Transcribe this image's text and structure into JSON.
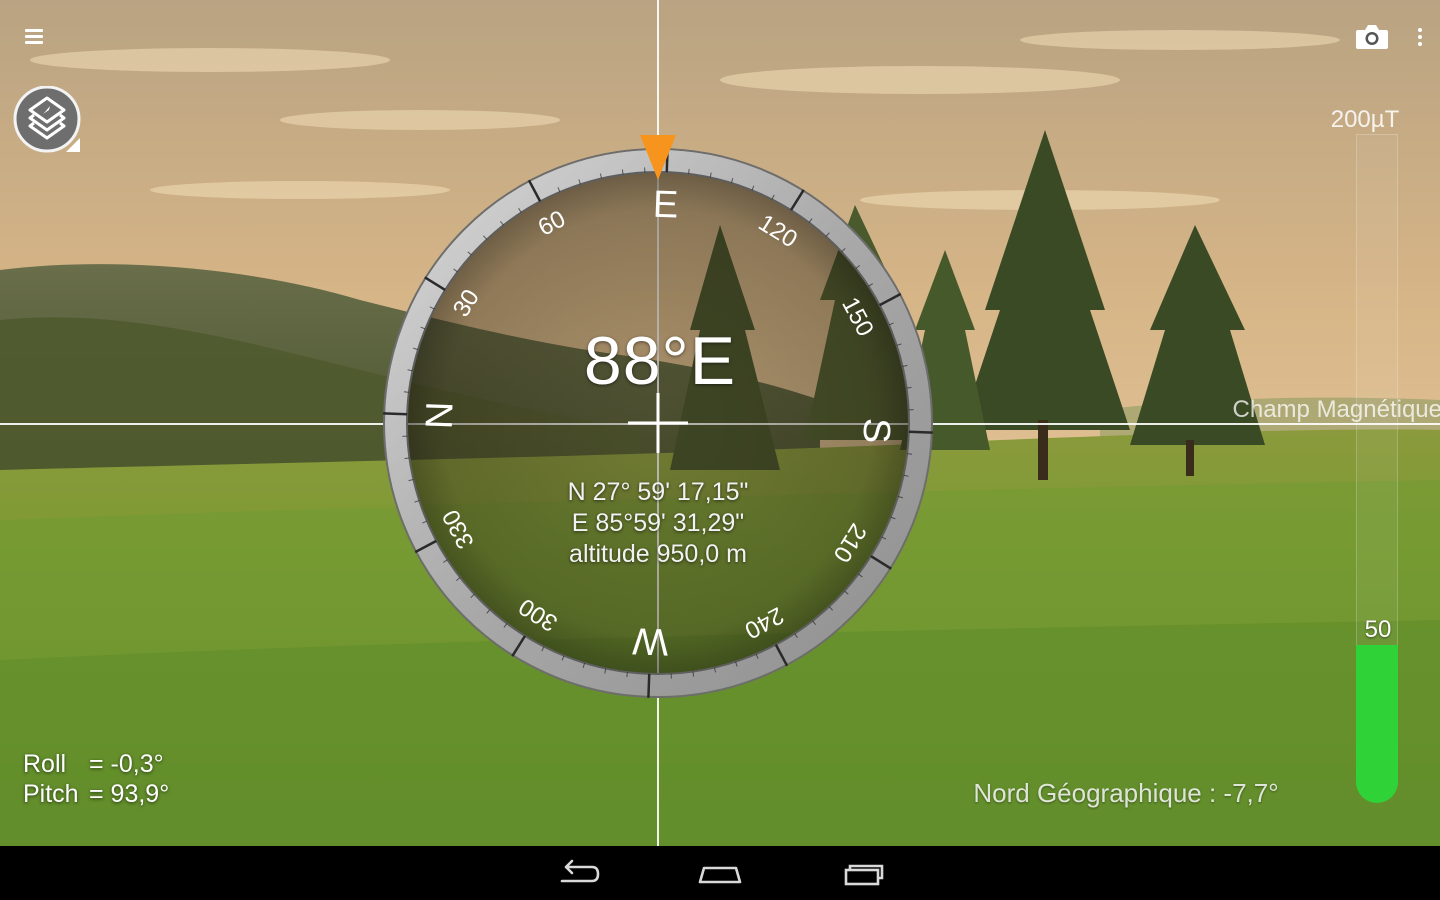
{
  "compass": {
    "heading": "88°E",
    "cardinals": {
      "north": "N",
      "east": "E",
      "south": "S",
      "west": "W"
    },
    "degree_labels": [
      "30",
      "60",
      "120",
      "150",
      "210",
      "240",
      "300",
      "330"
    ],
    "latitude": "N 27° 59' 17,15\"",
    "longitude": "E 85°59' 31,29\"",
    "altitude": "altitude 950,0 m",
    "heading_marker_color": "#f7941d"
  },
  "tilt": {
    "roll_label": "Roll",
    "roll_value": "= -0,3°",
    "pitch_label": "Pitch",
    "pitch_value": "= 93,9°"
  },
  "declination": "Nord Géographique : -7,7°",
  "magnetic_field": {
    "title": "Champ Magnétique",
    "max_label": "200µT",
    "value_label": "50",
    "level_fraction": 0.25,
    "fill_color": "#2fd338"
  },
  "toolbar": {
    "menu_icon": "hamburger-menu-icon",
    "camera_icon": "camera-icon",
    "more_icon": "more-vert-icon",
    "layers_icon": "layers-icon"
  },
  "navigation": {
    "back_icon": "back-icon",
    "home_icon": "home-icon",
    "recents_icon": "recent-apps-icon"
  }
}
